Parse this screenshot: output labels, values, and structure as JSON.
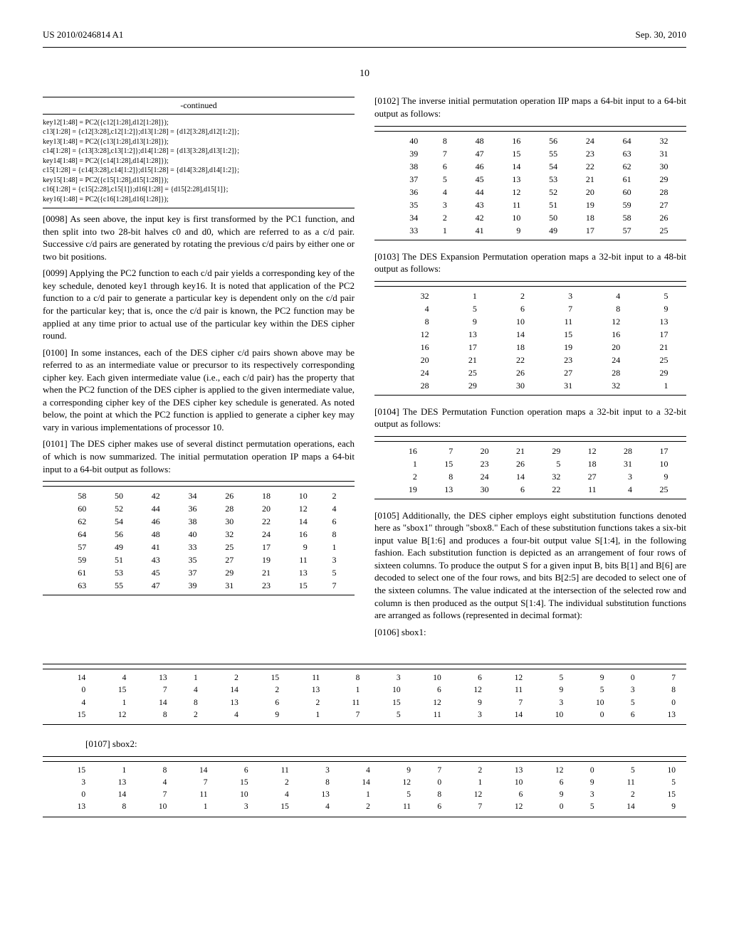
{
  "header": {
    "left": "US 2010/0246814 A1",
    "right": "Sep. 30, 2010"
  },
  "page_number": "10",
  "left_col": {
    "continued_label": "-continued",
    "code": "key12[1:48] = PC2({c12[1:28],d12[1:28]});\nc13[1:28] = {c12[3:28],c12[1:2]};d13[1:28] = {d12[3:28],d12[1:2]};\nkey13[1:48] = PC2({c13[1:28],d13[1:28]});\nc14[1:28] = {c13[3:28],c13[1:2]};d14[1:28] = {d13[3:28],d13[1:2]};\nkey14[1:48] = PC2({c14[1:28],d14[1:28]});\nc15[1:28] = {c14[3:28],c14[1:2]};d15[1:28] = {d14[3:28],d14[1:2]};\nkey15[1:48] = PC2({c15[1:28],d15[1:28]});\nc16[1:28] = {c15[2:28],c15[1]};d16[1:28] = {d15[2:28],d15[1]};\nkey16[1:48] = PC2({c16[1:28],d16[1:28]});",
    "p0098": "[0098]   As seen above, the input key is first transformed by the PC1 function, and then split into two 28-bit halves c0 and d0, which are referred to as a c/d pair. Successive c/d pairs are generated by rotating the previous c/d pairs by either one or two bit positions.",
    "p0099": "[0099]   Applying the PC2 function to each c/d pair yields a corresponding key of the key schedule, denoted key1 through key16. It is noted that application of the PC2 function to a c/d pair to generate a particular key is dependent only on the c/d pair for the particular key; that is, once the c/d pair is known, the PC2 function may be applied at any time prior to actual use of the particular key within the DES cipher round.",
    "p0100": "[0100]   In some instances, each of the DES cipher c/d pairs shown above may be referred to as an intermediate value or precursor to its respectively corresponding cipher key. Each given intermediate value (i.e., each c/d pair) has the property that when the PC2 function of the DES cipher is applied to the given intermediate value, a corresponding cipher key of the DES cipher key schedule is generated. As noted below, the point at which the PC2 function is applied to generate a cipher key may vary in various implementations of processor 10.",
    "p0101": "[0101]   The DES cipher makes use of several distinct permutation operations, each of which is now summarized. The initial permutation operation IP maps a 64-bit input to a 64-bit output as follows:",
    "ip_table": [
      [
        58,
        50,
        42,
        34,
        26,
        18,
        10,
        2
      ],
      [
        60,
        52,
        44,
        36,
        28,
        20,
        12,
        4
      ],
      [
        62,
        54,
        46,
        38,
        30,
        22,
        14,
        6
      ],
      [
        64,
        56,
        48,
        40,
        32,
        24,
        16,
        8
      ],
      [
        57,
        49,
        41,
        33,
        25,
        17,
        9,
        1
      ],
      [
        59,
        51,
        43,
        35,
        27,
        19,
        11,
        3
      ],
      [
        61,
        53,
        45,
        37,
        29,
        21,
        13,
        5
      ],
      [
        63,
        55,
        47,
        39,
        31,
        23,
        15,
        7
      ]
    ]
  },
  "right_col": {
    "p0102": "[0102]   The inverse initial permutation operation IIP maps a 64-bit input to a 64-bit output as follows:",
    "iip_table": [
      [
        40,
        8,
        48,
        16,
        56,
        24,
        64,
        32
      ],
      [
        39,
        7,
        47,
        15,
        55,
        23,
        63,
        31
      ],
      [
        38,
        6,
        46,
        14,
        54,
        22,
        62,
        30
      ],
      [
        37,
        5,
        45,
        13,
        53,
        21,
        61,
        29
      ],
      [
        36,
        4,
        44,
        12,
        52,
        20,
        60,
        28
      ],
      [
        35,
        3,
        43,
        11,
        51,
        19,
        59,
        27
      ],
      [
        34,
        2,
        42,
        10,
        50,
        18,
        58,
        26
      ],
      [
        33,
        1,
        41,
        9,
        49,
        17,
        57,
        25
      ]
    ],
    "p0103": "[0103]   The DES Expansion Permutation operation maps a 32-bit input to a 48-bit output as follows:",
    "exp_table": [
      [
        32,
        1,
        2,
        3,
        4,
        5
      ],
      [
        4,
        5,
        6,
        7,
        8,
        9
      ],
      [
        8,
        9,
        10,
        11,
        12,
        13
      ],
      [
        12,
        13,
        14,
        15,
        16,
        17
      ],
      [
        16,
        17,
        18,
        19,
        20,
        21
      ],
      [
        20,
        21,
        22,
        23,
        24,
        25
      ],
      [
        24,
        25,
        26,
        27,
        28,
        29
      ],
      [
        28,
        29,
        30,
        31,
        32,
        1
      ]
    ],
    "p0104": "[0104]   The DES Permutation Function operation maps a 32-bit input to a 32-bit output as follows:",
    "pf_table": [
      [
        16,
        7,
        20,
        21,
        29,
        12,
        28,
        17
      ],
      [
        1,
        15,
        23,
        26,
        5,
        18,
        31,
        10
      ],
      [
        2,
        8,
        24,
        14,
        32,
        27,
        3,
        9
      ],
      [
        19,
        13,
        30,
        6,
        22,
        11,
        4,
        25
      ]
    ],
    "p0105": "[0105]   Additionally, the DES cipher employs eight substitution functions denoted here as \"sbox1\" through \"sbox8.\" Each of these substitution functions takes a six-bit input value B[1:6] and produces a four-bit output value S[1:4], in the following fashion. Each substitution function is depicted as an arrangement of four rows of sixteen columns. To produce the output S for a given input B, bits B[1] and B[6] are decoded to select one of the four rows, and bits B[2:5] are decoded to select one of the sixteen columns. The value indicated at the intersection of the selected row and column is then produced as the output S[1:4]. The individual substitution functions are arranged as follows (represented in decimal format):",
    "p0106": "[0106]   sbox1:"
  },
  "sbox1": [
    [
      14,
      4,
      13,
      1,
      2,
      15,
      11,
      8,
      3,
      10,
      6,
      12,
      5,
      9,
      0,
      7
    ],
    [
      0,
      15,
      7,
      4,
      14,
      2,
      13,
      1,
      10,
      6,
      12,
      11,
      9,
      5,
      3,
      8
    ],
    [
      4,
      1,
      14,
      8,
      13,
      6,
      2,
      11,
      15,
      12,
      9,
      7,
      3,
      10,
      5,
      0
    ],
    [
      15,
      12,
      8,
      2,
      4,
      9,
      1,
      7,
      5,
      11,
      3,
      14,
      10,
      0,
      6,
      13
    ]
  ],
  "p0107": "[0107]   sbox2:",
  "sbox2": [
    [
      15,
      1,
      8,
      14,
      6,
      11,
      3,
      4,
      9,
      7,
      2,
      13,
      12,
      0,
      5,
      10
    ],
    [
      3,
      13,
      4,
      7,
      15,
      2,
      8,
      14,
      12,
      0,
      1,
      10,
      6,
      9,
      11,
      5
    ],
    [
      0,
      14,
      7,
      11,
      10,
      4,
      13,
      1,
      5,
      8,
      12,
      6,
      9,
      3,
      2,
      15
    ],
    [
      13,
      8,
      10,
      1,
      3,
      15,
      4,
      2,
      11,
      6,
      7,
      12,
      0,
      5,
      14,
      9
    ]
  ]
}
